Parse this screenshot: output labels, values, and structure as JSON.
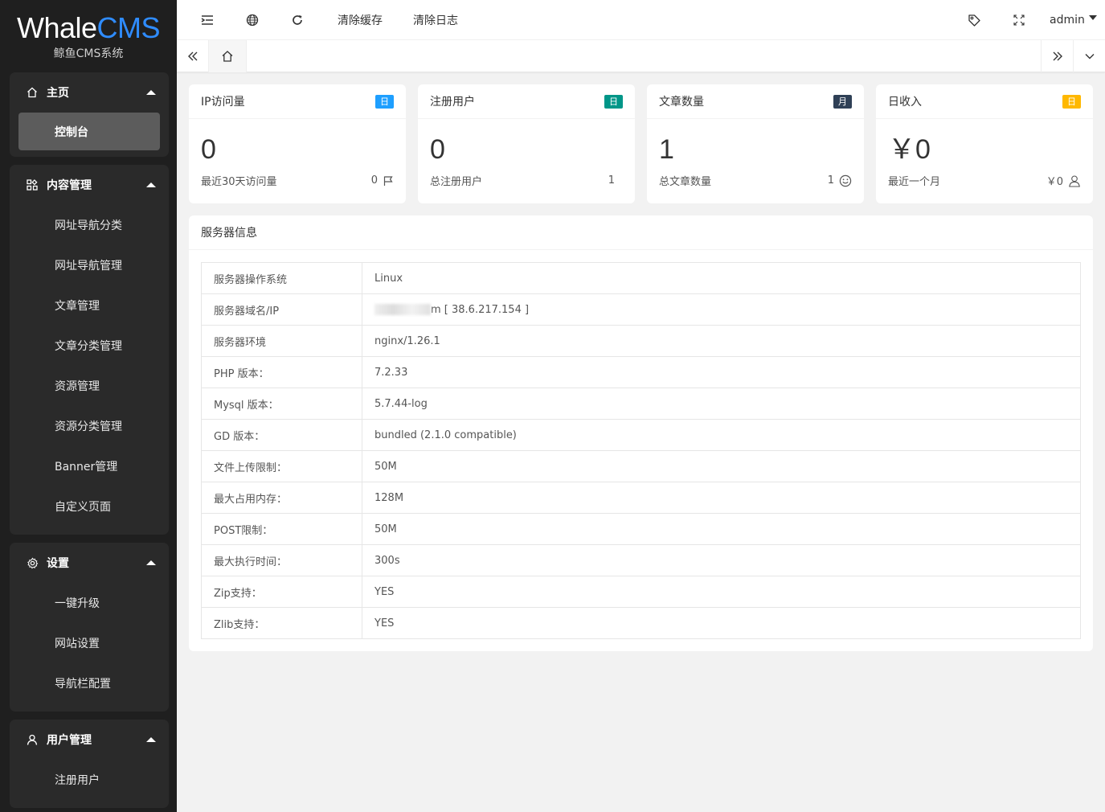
{
  "logo": {
    "main_a": "Whale",
    "main_b": "CMS",
    "sub": "鲸鱼CMS系统"
  },
  "sidebar": {
    "groups": [
      {
        "label": "主页",
        "icon": "home-icon",
        "items": [
          "控制台"
        ]
      },
      {
        "label": "内容管理",
        "icon": "apps-icon",
        "items": [
          "网址导航分类",
          "网址导航管理",
          "文章管理",
          "文章分类管理",
          "资源管理",
          "资源分类管理",
          "Banner管理",
          "自定义页面"
        ]
      },
      {
        "label": "设置",
        "icon": "gear-icon",
        "items": [
          "一键升级",
          "网站设置",
          "导航栏配置"
        ]
      },
      {
        "label": "用户管理",
        "icon": "user-icon",
        "items": [
          "注册用户"
        ]
      }
    ]
  },
  "header": {
    "clear_cache": "清除缓存",
    "clear_log": "清除日志",
    "user": "admin"
  },
  "stats": [
    {
      "title": "IP访问量",
      "badge": "日",
      "badge_color": "#1E9FFF",
      "value": "0",
      "foot_label": "最近30天访问量",
      "foot_value": "0",
      "foot_icon": "flag-icon"
    },
    {
      "title": "注册用户",
      "badge": "日",
      "badge_color": "#009688",
      "value": "0",
      "foot_label": "总注册用户",
      "foot_value": "1",
      "foot_icon": ""
    },
    {
      "title": "文章数量",
      "badge": "月",
      "badge_color": "#2F4056",
      "value": "1",
      "foot_label": "总文章数量",
      "foot_value": "1",
      "foot_icon": "smile-icon"
    },
    {
      "title": "日收入",
      "badge": "日",
      "badge_color": "#FFB800",
      "value": "￥0",
      "foot_label": "最近一个月",
      "foot_value": "￥0",
      "foot_icon": "user-outline-icon"
    }
  ],
  "server": {
    "title": "服务器信息",
    "rows": [
      {
        "k": "服务器操作系统",
        "v": "Linux"
      },
      {
        "k": "服务器域名/IP",
        "v": "m [ 38.6.217.154 ]"
      },
      {
        "k": "服务器环境",
        "v": "nginx/1.26.1"
      },
      {
        "k": "PHP 版本：",
        "v": "7.2.33"
      },
      {
        "k": "Mysql 版本：",
        "v": "5.7.44-log"
      },
      {
        "k": "GD 版本：",
        "v": "bundled (2.1.0 compatible)"
      },
      {
        "k": "文件上传限制：",
        "v": "50M"
      },
      {
        "k": "最大占用内存：",
        "v": "128M"
      },
      {
        "k": "POST限制：",
        "v": "50M"
      },
      {
        "k": "最大执行时间：",
        "v": "300s"
      },
      {
        "k": "Zip支持：",
        "v": "YES"
      },
      {
        "k": "Zlib支持：",
        "v": "YES"
      }
    ]
  }
}
